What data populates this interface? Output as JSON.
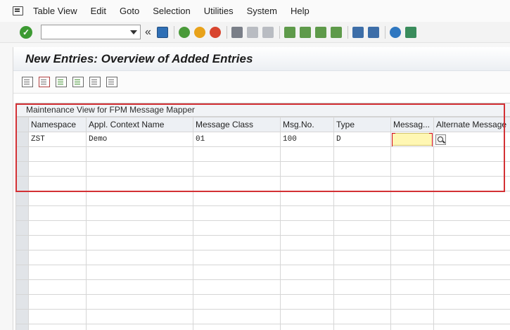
{
  "menu": {
    "items": [
      {
        "first": "T",
        "rest": "able View"
      },
      {
        "first": "E",
        "rest": "dit"
      },
      {
        "first": "G",
        "rest": "oto"
      },
      {
        "first": "Sel",
        "rest": "ection",
        "u_index": 2
      },
      {
        "first": "U",
        "rest": "tilities"
      },
      {
        "first": "S",
        "rest": "ystem",
        "u_index": 1
      },
      {
        "first": "H",
        "rest": "elp"
      }
    ],
    "labels": [
      "Table View",
      "Edit",
      "Goto",
      "Selection",
      "Utilities",
      "System",
      "Help"
    ]
  },
  "toolbar": {
    "command_field_value": "",
    "back_chevron": "«",
    "icons": [
      "save-icon",
      "back-icon",
      "exit-icon",
      "cancel-icon",
      "print-icon",
      "find-icon",
      "find-next-icon",
      "first-page-icon",
      "previous-page-icon",
      "next-page-icon",
      "last-page-icon",
      "create-session-icon",
      "shortcut-icon",
      "help-icon",
      "layout-icon"
    ]
  },
  "page": {
    "title": "New Entries: Overview of Added Entries"
  },
  "table": {
    "caption": "Maintenance View for FPM Message Mapper",
    "columns": [
      "Namespace",
      "Appl. Context Name",
      "Message Class",
      "Msg.No.",
      "Type",
      "Messag...",
      "Alternate Message"
    ],
    "rows": [
      {
        "namespace": "ZST",
        "context": "Demo",
        "msg_class": "01",
        "msg_no": "100",
        "type": "D",
        "message": "",
        "alt_message": ""
      }
    ]
  },
  "colors": {
    "highlight": "#d33034",
    "active_input": "#fff7b3",
    "ok_green": "#3c9a32"
  }
}
